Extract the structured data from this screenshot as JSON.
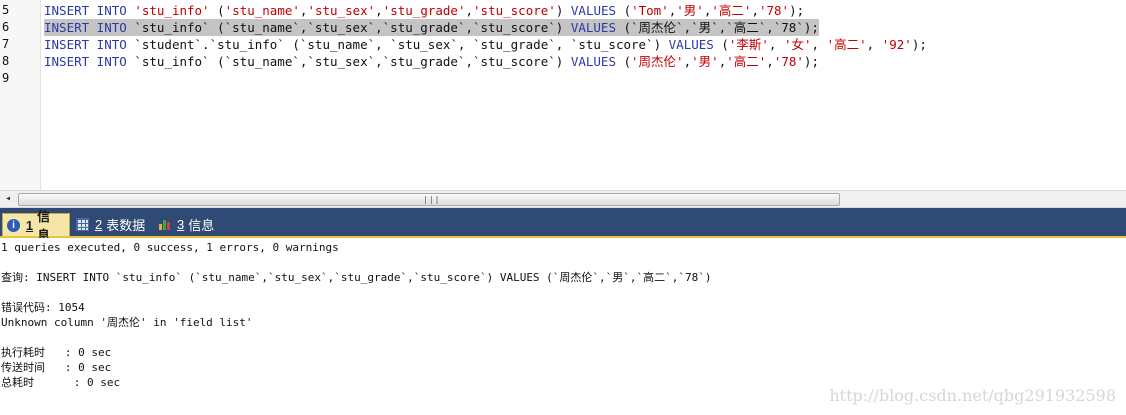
{
  "editor": {
    "lines": [
      {
        "number": "5",
        "highlighted": false,
        "tokens": [
          {
            "t": "INSERT INTO ",
            "c": "kw"
          },
          {
            "t": "'stu_info'",
            "c": "str"
          },
          {
            "t": " (",
            "c": "plain"
          },
          {
            "t": "'stu_name'",
            "c": "str"
          },
          {
            "t": ",",
            "c": "plain"
          },
          {
            "t": "'stu_sex'",
            "c": "str"
          },
          {
            "t": ",",
            "c": "plain"
          },
          {
            "t": "'stu_grade'",
            "c": "str"
          },
          {
            "t": ",",
            "c": "plain"
          },
          {
            "t": "'stu_score'",
            "c": "str"
          },
          {
            "t": ") ",
            "c": "plain"
          },
          {
            "t": "VALUES",
            "c": "kw"
          },
          {
            "t": " (",
            "c": "plain"
          },
          {
            "t": "'Tom'",
            "c": "str"
          },
          {
            "t": ",",
            "c": "plain"
          },
          {
            "t": "'男'",
            "c": "str"
          },
          {
            "t": ",",
            "c": "plain"
          },
          {
            "t": "'高二'",
            "c": "str"
          },
          {
            "t": ",",
            "c": "plain"
          },
          {
            "t": "'78'",
            "c": "str"
          },
          {
            "t": ");",
            "c": "plain"
          }
        ]
      },
      {
        "number": "6",
        "highlighted": true,
        "tokens": [
          {
            "t": "INSERT INTO ",
            "c": "kw"
          },
          {
            "t": "`stu_info` (`stu_name`,`stu_sex`,`stu_grade`,`stu_score`) ",
            "c": "plain"
          },
          {
            "t": "VALUES",
            "c": "kw"
          },
          {
            "t": " (`周杰伦`,`男`,`高二`,`78`);",
            "c": "plain"
          }
        ]
      },
      {
        "number": "7",
        "highlighted": false,
        "tokens": [
          {
            "t": "INSERT INTO ",
            "c": "kw"
          },
          {
            "t": "`student`.`stu_info` (`stu_name`, `stu_sex`, `stu_grade`, `stu_score`) ",
            "c": "plain"
          },
          {
            "t": "VALUES",
            "c": "kw"
          },
          {
            "t": " (",
            "c": "plain"
          },
          {
            "t": "'李斯'",
            "c": "str"
          },
          {
            "t": ", ",
            "c": "plain"
          },
          {
            "t": "'女'",
            "c": "str"
          },
          {
            "t": ", ",
            "c": "plain"
          },
          {
            "t": "'高二'",
            "c": "str"
          },
          {
            "t": ", ",
            "c": "plain"
          },
          {
            "t": "'92'",
            "c": "str"
          },
          {
            "t": ");",
            "c": "plain"
          }
        ]
      },
      {
        "number": "8",
        "highlighted": false,
        "tokens": [
          {
            "t": "INSERT INTO ",
            "c": "kw"
          },
          {
            "t": "`stu_info` (`stu_name`,`stu_sex`,`stu_grade`,`stu_score`) ",
            "c": "plain"
          },
          {
            "t": "VALUES",
            "c": "kw"
          },
          {
            "t": " (",
            "c": "plain"
          },
          {
            "t": "'周杰伦'",
            "c": "str"
          },
          {
            "t": ",",
            "c": "plain"
          },
          {
            "t": "'男'",
            "c": "str"
          },
          {
            "t": ",",
            "c": "plain"
          },
          {
            "t": "'高二'",
            "c": "str"
          },
          {
            "t": ",",
            "c": "plain"
          },
          {
            "t": "'78'",
            "c": "str"
          },
          {
            "t": ");",
            "c": "plain"
          }
        ]
      },
      {
        "number": "9",
        "highlighted": false,
        "tokens": []
      }
    ]
  },
  "scrollbar": {
    "left_arrow": "◂",
    "grip": "|||"
  },
  "tabs": [
    {
      "number": "1",
      "label": "信息",
      "icon": "info-icon",
      "active": true
    },
    {
      "number": "2",
      "label": "表数据",
      "icon": "table-grid-icon",
      "active": false
    },
    {
      "number": "3",
      "label": "信息",
      "icon": "chart-icon",
      "active": false
    }
  ],
  "messages": {
    "summary": "1 queries executed, 0 success, 1 errors, 0 warnings",
    "query": "查询: INSERT INTO `stu_info` (`stu_name`,`stu_sex`,`stu_grade`,`stu_score`) VALUES (`周杰伦`,`男`,`高二`,`78`)",
    "error_code": "错误代码: 1054",
    "error_message": "Unknown column '周杰伦' in 'field list'",
    "exec_time": "执行耗时   : 0 sec",
    "transfer_time": "传送时间   : 0 sec",
    "total_time": "总耗时      : 0 sec"
  },
  "watermark": "http://blog.csdn.net/qbg291932598",
  "colors": {
    "keyword": "#2b3aa8",
    "string": "#c00000",
    "tabbar": "#2f4a74",
    "active_tab": "#f5e6a8",
    "highlight": "#c4c4c4"
  }
}
